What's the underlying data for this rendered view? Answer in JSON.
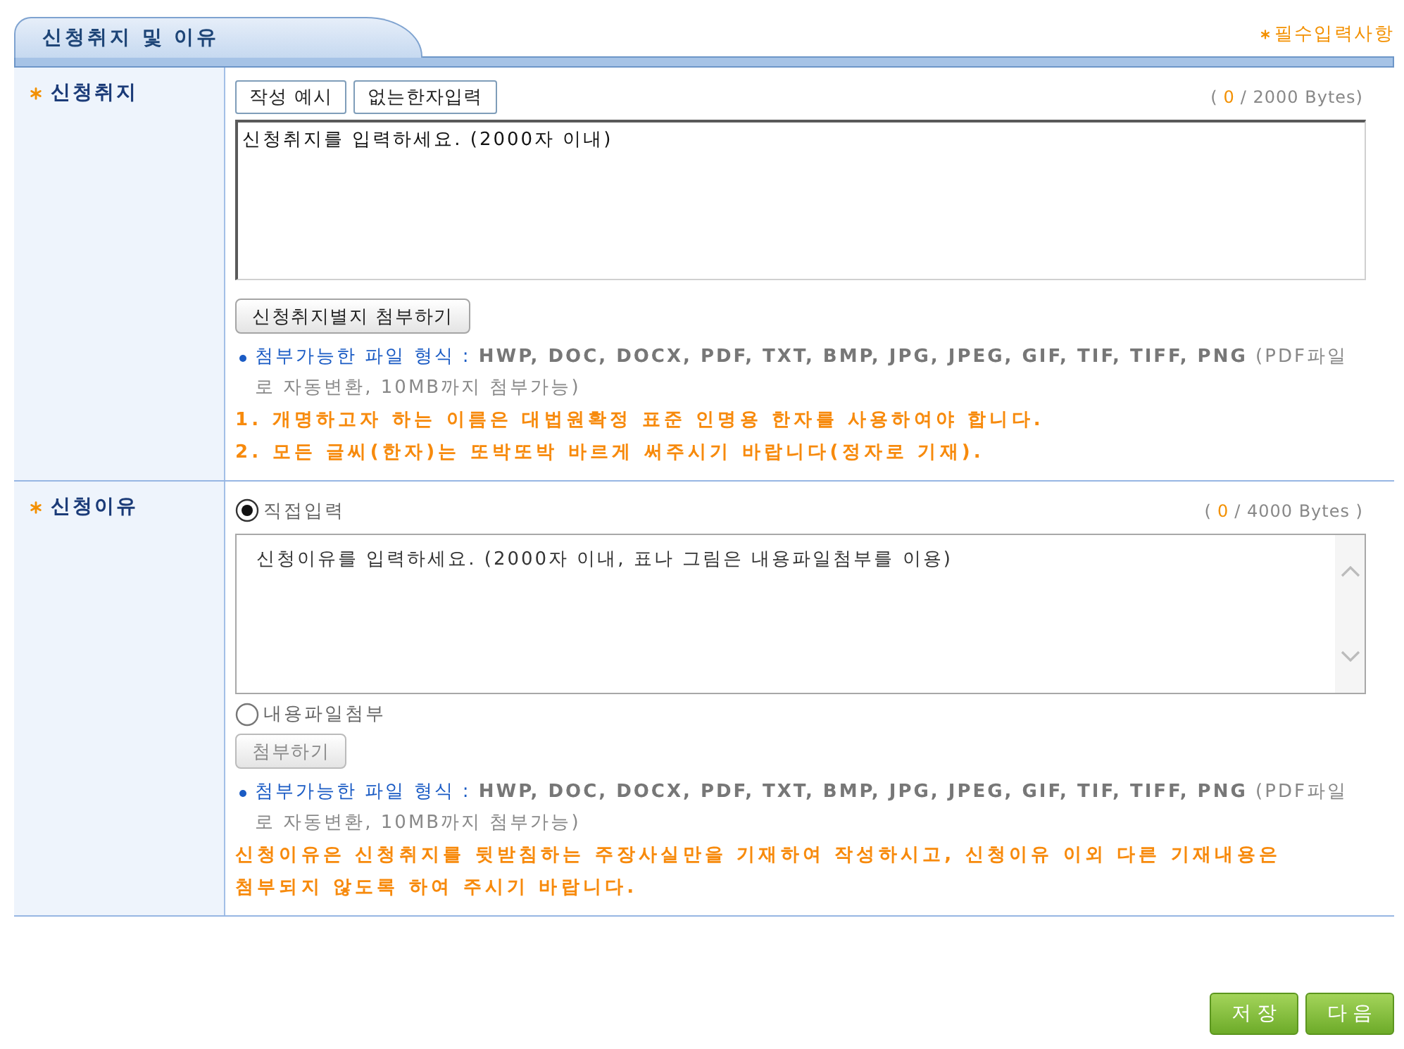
{
  "section": {
    "title": "신청취지 및 이유"
  },
  "required_note": {
    "text": "필수입력사항"
  },
  "rows": [
    {
      "label": "신청취지",
      "required": true,
      "blocks": [
        {
          "kind": "toolbar",
          "items": [
            {
              "kind": "button",
              "label": "작성 예시"
            },
            {
              "kind": "button",
              "label": "없는한자입력"
            }
          ],
          "counter": {
            "open": "(",
            "count": "0",
            "rest": "/ 2000 Bytes)"
          }
        },
        {
          "kind": "textarea",
          "placeholder": "신청취지를 입력하세요. (2000자 이내)",
          "scrollbar": false
        },
        {
          "kind": "button",
          "label": "신청취지별지 첨부하기",
          "disabled": false
        },
        {
          "kind": "filetypes",
          "lead": "첨부가능한 파일 형식 :",
          "formats": "HWP, DOC, DOCX, PDF, TXT, BMP, JPG, JPEG, GIF, TIF, TIFF, PNG",
          "tail": "(PDF파일로 자동변환, 10MB까지 첨부가능)"
        },
        {
          "kind": "warnings",
          "lines": [
            "1. 개명하고자 하는 이름은 대법원확정 표준 인명용 한자를 사용하여야 합니다.",
            "2. 모든 글씨(한자)는 또박또박 바르게 써주시기 바랍니다(정자로 기재)."
          ]
        }
      ]
    },
    {
      "label": "신청이유",
      "required": true,
      "blocks": [
        {
          "kind": "toolbar",
          "items": [
            {
              "kind": "radio",
              "label": "직접입력",
              "selected": true
            }
          ],
          "counter": {
            "open": "(",
            "count": "0",
            "rest": "/ 4000 Bytes )"
          }
        },
        {
          "kind": "textarea",
          "placeholder": "신청이유를 입력하세요. (2000자 이내, 표나 그림은 내용파일첨부를 이용)",
          "scrollbar": true
        },
        {
          "kind": "radio",
          "label": "내용파일첨부",
          "selected": false
        },
        {
          "kind": "button",
          "label": "첨부하기",
          "disabled": true
        },
        {
          "kind": "filetypes",
          "lead": "첨부가능한 파일 형식 :",
          "formats": "HWP, DOC, DOCX, PDF, TXT, BMP, JPG, JPEG, GIF, TIF, TIFF, PNG",
          "tail": "(PDF파일로 자동변환, 10MB까지 첨부가능)"
        },
        {
          "kind": "warnings",
          "lines": [
            "신청이유은 신청취지를 뒷받침하는 주장사실만을 기재하여 작성하시고, 신청이유 이외 다른 기재내용은 첨부되지 않도록 하여 주시기 바랍니다."
          ]
        }
      ]
    }
  ],
  "actions": [
    {
      "label": "저 장"
    },
    {
      "label": "다 음"
    }
  ]
}
